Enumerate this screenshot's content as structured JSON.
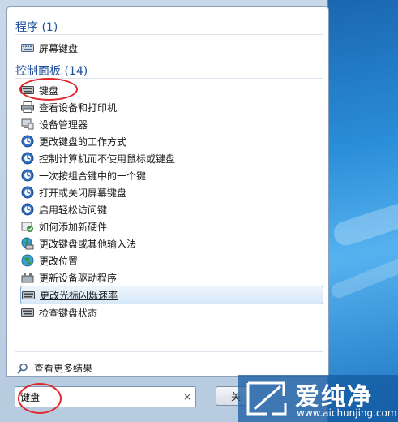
{
  "programs": {
    "header": "程序 (1)",
    "items": [
      {
        "label": "屏幕键盘",
        "icon": "keyboard-icon"
      }
    ]
  },
  "control_panel": {
    "header": "控制面板 (14)",
    "items": [
      {
        "label": "键盘",
        "icon": "keyboard-icon"
      },
      {
        "label": "查看设备和打印机",
        "icon": "printer-icon"
      },
      {
        "label": "设备管理器",
        "icon": "device-manager-icon"
      },
      {
        "label": "更改键盘的工作方式",
        "icon": "ease-of-access-icon"
      },
      {
        "label": "控制计算机而不使用鼠标或键盘",
        "icon": "ease-of-access-icon"
      },
      {
        "label": "一次按组合键中的一个键",
        "icon": "ease-of-access-icon"
      },
      {
        "label": "打开或关闭屏幕键盘",
        "icon": "ease-of-access-icon"
      },
      {
        "label": "启用轻松访问键",
        "icon": "ease-of-access-icon"
      },
      {
        "label": "如何添加新硬件",
        "icon": "help-hardware-icon"
      },
      {
        "label": "更改键盘或其他输入法",
        "icon": "globe-keyboard-icon"
      },
      {
        "label": "更改位置",
        "icon": "globe-icon"
      },
      {
        "label": "更新设备驱动程序",
        "icon": "driver-update-icon"
      },
      {
        "label": "更改光标闪烁速率",
        "icon": "keyboard-icon"
      },
      {
        "label": "检查键盘状态",
        "icon": "keyboard-icon"
      }
    ]
  },
  "more_results": "查看更多结果",
  "search": {
    "value": "键盘",
    "clear": "×"
  },
  "shutdown_label": "关",
  "watermark": {
    "brand": "爱纯净",
    "url": "www.aichunjing.com"
  },
  "colors": {
    "header": "#1e4f9c",
    "highlight": "#d6e8f8",
    "annotation": "#e0262a"
  }
}
